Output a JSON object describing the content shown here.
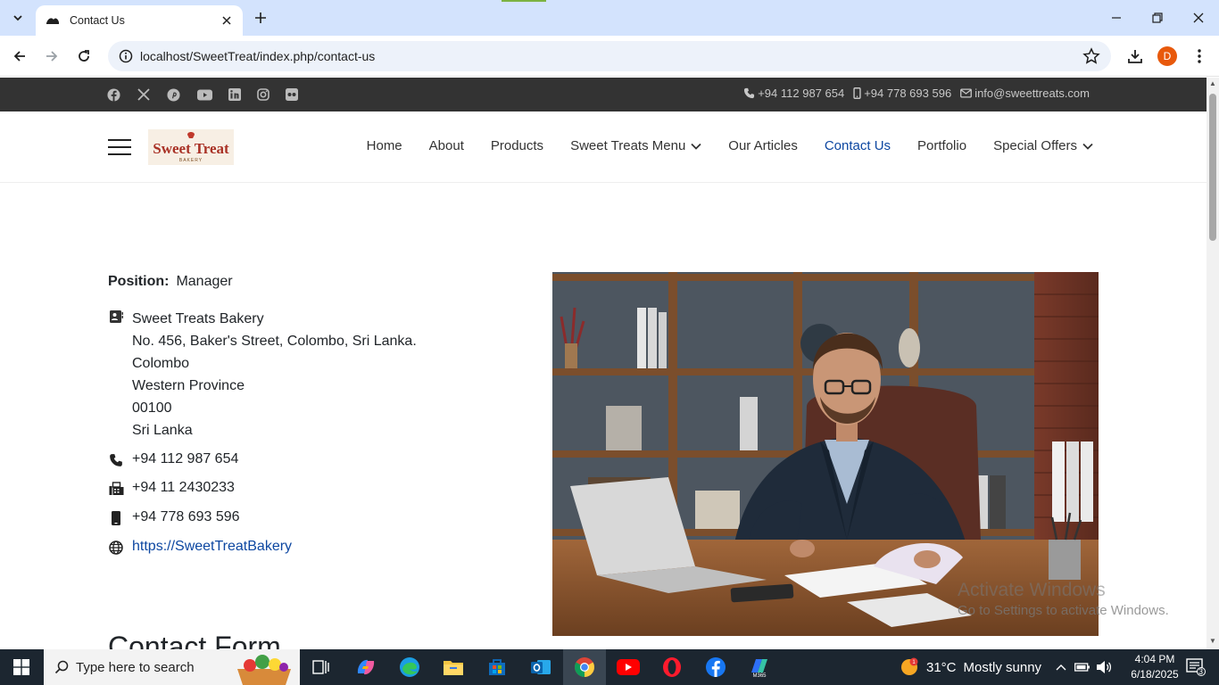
{
  "browser": {
    "tab_title": "Contact Us",
    "url": "localhost/SweetTreat/index.php/contact-us",
    "profile_initial": "D"
  },
  "topbar": {
    "socials": [
      "facebook-icon",
      "x-icon",
      "pinterest-icon",
      "youtube-icon",
      "linkedin-icon",
      "instagram-icon",
      "flickr-icon"
    ],
    "phone": "+94 112 987 654",
    "mobile": "+94 778 693 596",
    "email": "info@sweettreats.com"
  },
  "header": {
    "logo_text": "Sweet Treat",
    "logo_subtext": "BAKERY",
    "nav": [
      {
        "label": "Home"
      },
      {
        "label": "About"
      },
      {
        "label": "Products"
      },
      {
        "label": "Sweet Treats Menu",
        "dropdown": true
      },
      {
        "label": "Our Articles"
      },
      {
        "label": "Contact Us",
        "active": true
      },
      {
        "label": "Portfolio"
      },
      {
        "label": "Special Offers",
        "dropdown": true
      }
    ]
  },
  "contact": {
    "position_label": "Position:",
    "position_value": "Manager",
    "address": [
      "Sweet Treats Bakery",
      "No. 456, Baker's Street, Colombo, Sri Lanka.",
      "Colombo",
      "Western Province",
      "00100",
      "Sri Lanka"
    ],
    "telephone": "+94 112 987 654",
    "fax": "+94 11 2430233",
    "mobile": "+94 778 693 596",
    "website": "https://SweetTreatBakery"
  },
  "form_title": "Contact Form",
  "watermark": {
    "line1": "Activate Windows",
    "line2": "Go to Settings to activate Windows."
  },
  "taskbar": {
    "search_placeholder": "Type here to search",
    "weather_temp": "31°C",
    "weather_desc": "Mostly sunny",
    "time": "4:04 PM",
    "date": "6/18/2025",
    "notification_count": "3"
  }
}
